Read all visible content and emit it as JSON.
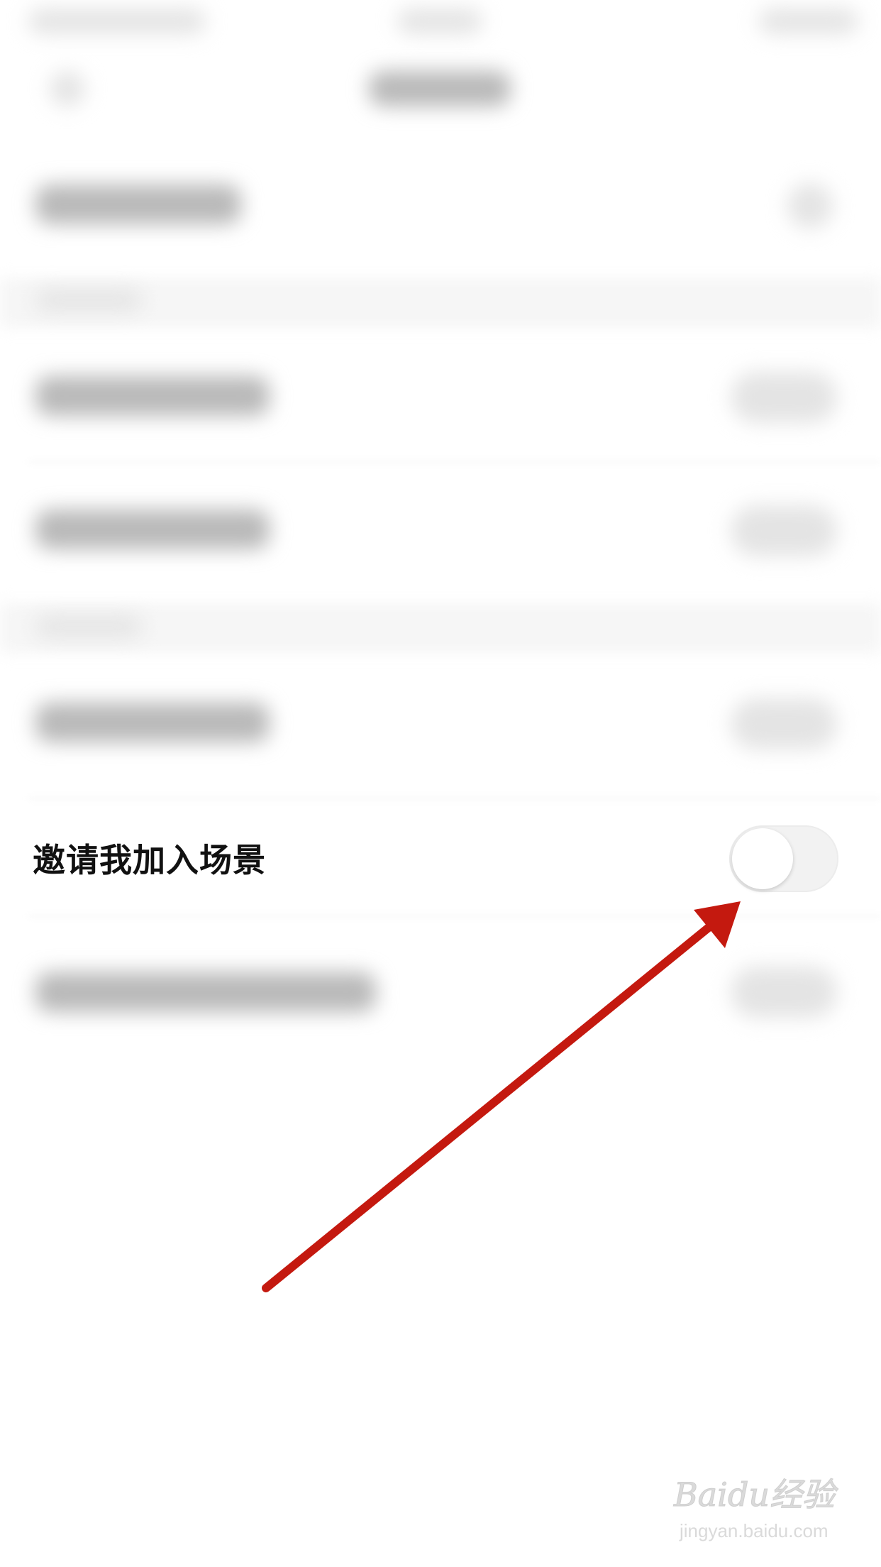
{
  "settings": {
    "invite_row": {
      "label": "邀请我加入场景",
      "toggle_on": false
    }
  },
  "colors": {
    "annotation_arrow": "#c4190f",
    "toggle_off_track": "#f2f2f2",
    "label_text": "#111111"
  },
  "watermark": {
    "logo": "Baidu经验",
    "site": "jingyan.baidu.com"
  }
}
